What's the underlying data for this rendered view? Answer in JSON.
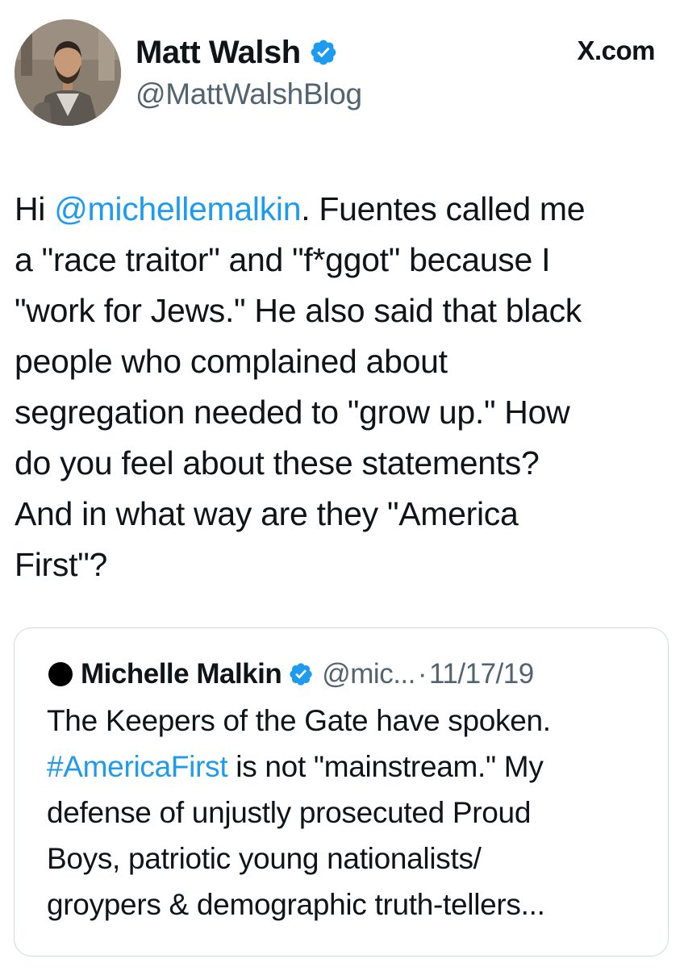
{
  "author": {
    "display_name": "Matt Walsh",
    "handle": "@MattWalshBlog",
    "verified": true
  },
  "brand": {
    "site_label": "X.com"
  },
  "tweet": {
    "lines": [
      {
        "mention": "@michellemalkin",
        "pre": "Hi ",
        "post": ". Fuentes called me"
      },
      {
        "text": "a \"race traitor\" and \"f*ggot\" because I"
      },
      {
        "text": "\"work for Jews.\" He also said that black"
      },
      {
        "text": "people who complained about"
      },
      {
        "text": "segregation needed to \"grow up.\" How"
      },
      {
        "text": "do you feel about these statements?"
      },
      {
        "text": "And in what way are they \"America"
      },
      {
        "text": "First\"?"
      }
    ]
  },
  "quoted_tweet": {
    "display_name": "Michelle Malkin",
    "handle": "@mic...",
    "separator": "·",
    "date": "11/17/19",
    "verified": true,
    "lines": [
      {
        "text": "The Keepers of the Gate have spoken."
      },
      {
        "hashtag": "#AmericaFirst",
        "post": " is not \"mainstream.\" My"
      },
      {
        "text": "defense of unjustly prosecuted Proud"
      },
      {
        "text": "Boys, patriotic young nationalists/"
      },
      {
        "text": "groypers & demographic truth-tellers..."
      }
    ]
  },
  "colors": {
    "link": "#1d9bf0",
    "verified_badge": "#1d9bf0",
    "secondary_text": "#536471",
    "primary_text": "#0f1419",
    "card_border": "#cfd9de"
  },
  "icons": {
    "verified": "verified-badge-icon",
    "quote_avatar": "black-circle-avatar",
    "author_avatar": "profile-photo"
  }
}
